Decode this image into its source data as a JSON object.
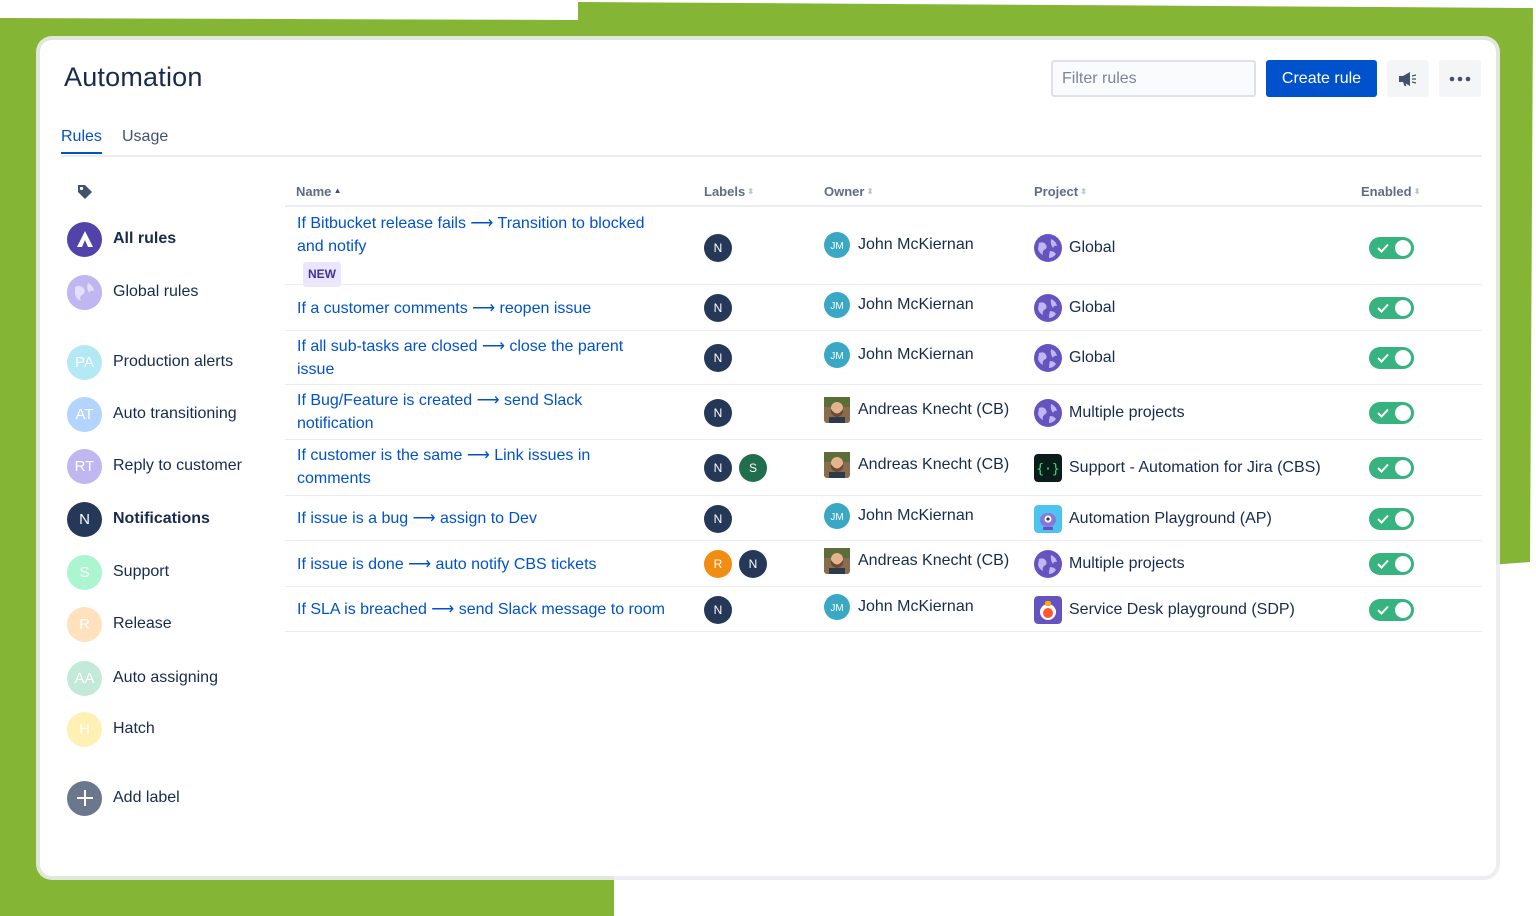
{
  "header": {
    "title": "Automation",
    "filter_placeholder": "Filter rules",
    "create_label": "Create rule",
    "feedback_icon": "megaphone-icon",
    "more_icon": "more-dots-icon"
  },
  "tabs": [
    {
      "label": "Rules",
      "active": true
    },
    {
      "label": "Usage",
      "active": false
    }
  ],
  "sidebar": {
    "tag_icon": "tag-icon",
    "items": [
      {
        "label": "All rules",
        "initials": "",
        "color": "#5243aa",
        "bold": true
      },
      {
        "label": "Global rules",
        "initials": "",
        "color": "#c0b6f2",
        "bold": false
      },
      {
        "label": "Production alerts",
        "initials": "PA",
        "color": "#b3e8f5",
        "bold": false
      },
      {
        "label": "Auto transitioning",
        "initials": "AT",
        "color": "#b3d4ff",
        "bold": false
      },
      {
        "label": "Reply to customer",
        "initials": "RT",
        "color": "#c0b6f2",
        "bold": false
      },
      {
        "label": "Notifications",
        "initials": "N",
        "color": "#253858",
        "bold": true
      },
      {
        "label": "Support",
        "initials": "S",
        "color": "#abf5d1",
        "bold": false
      },
      {
        "label": "Release",
        "initials": "R",
        "color": "#ffe2bd",
        "bold": false
      },
      {
        "label": "Auto assigning",
        "initials": "AA",
        "color": "#c3ead9",
        "bold": false
      },
      {
        "label": "Hatch",
        "initials": "H",
        "color": "#fff0b3",
        "bold": false
      }
    ],
    "add_label": "Add label"
  },
  "table": {
    "columns": {
      "name": "Name",
      "labels": "Labels",
      "owner": "Owner",
      "project": "Project",
      "enabled": "Enabled"
    },
    "rows": [
      {
        "line1": "If Bitbucket release fails ⟶ Transition to blocked",
        "line2": "and notify",
        "badge": "NEW",
        "labels": [
          {
            "text": "N",
            "color": "#253858"
          }
        ],
        "owner": "John McKiernan",
        "owner_type": "jm",
        "project": "Global",
        "project_type": "global",
        "enabled": true
      },
      {
        "line1": "If a customer comments ⟶ reopen issue",
        "line2": "",
        "badge": "",
        "labels": [
          {
            "text": "N",
            "color": "#253858"
          }
        ],
        "owner": "John McKiernan",
        "owner_type": "jm",
        "project": "Global",
        "project_type": "global",
        "enabled": true
      },
      {
        "line1": "If all sub-tasks are closed ⟶ close the parent",
        "line2": "issue",
        "badge": "",
        "labels": [
          {
            "text": "N",
            "color": "#253858"
          }
        ],
        "owner": "John McKiernan",
        "owner_type": "jm",
        "project": "Global",
        "project_type": "global",
        "enabled": true
      },
      {
        "line1": "If Bug/Feature is created ⟶ send Slack",
        "line2": "notification",
        "badge": "",
        "labels": [
          {
            "text": "N",
            "color": "#253858"
          }
        ],
        "owner": "Andreas Knecht (CB)",
        "owner_type": "photo",
        "project": "Multiple projects",
        "project_type": "global",
        "enabled": true
      },
      {
        "line1": "If customer is the same ⟶ Link issues in",
        "line2": "comments",
        "badge": "",
        "labels": [
          {
            "text": "N",
            "color": "#253858"
          },
          {
            "text": "S",
            "color": "#216e4e"
          }
        ],
        "owner": "Andreas Knecht (CB)",
        "owner_type": "photo",
        "project": "Support - Automation for Jira (CBS)",
        "project_type": "code",
        "enabled": true
      },
      {
        "line1": "If issue is a bug ⟶ assign to Dev",
        "line2": "",
        "badge": "",
        "labels": [
          {
            "text": "N",
            "color": "#253858"
          }
        ],
        "owner": "John McKiernan",
        "owner_type": "jm",
        "project": "Automation Playground (AP)",
        "project_type": "robot",
        "enabled": true
      },
      {
        "line1": "If issue is done ⟶ auto notify CBS tickets",
        "line2": "",
        "badge": "",
        "labels": [
          {
            "text": "R",
            "color": "#f18d13"
          },
          {
            "text": "N",
            "color": "#253858"
          }
        ],
        "owner": "Andreas Knecht (CB)",
        "owner_type": "photo",
        "project": "Multiple projects",
        "project_type": "global",
        "enabled": true
      },
      {
        "line1": "If SLA is breached ⟶ send Slack message to room",
        "line2": "",
        "badge": "",
        "labels": [
          {
            "text": "N",
            "color": "#253858"
          }
        ],
        "owner": "John McKiernan",
        "owner_type": "jm",
        "project": "Service Desk playground (SDP)",
        "project_type": "sdp",
        "enabled": true
      }
    ]
  },
  "colors": {
    "accent": "#0052cc",
    "brand_green": "#84b534",
    "toggle_on": "#36b37e"
  }
}
